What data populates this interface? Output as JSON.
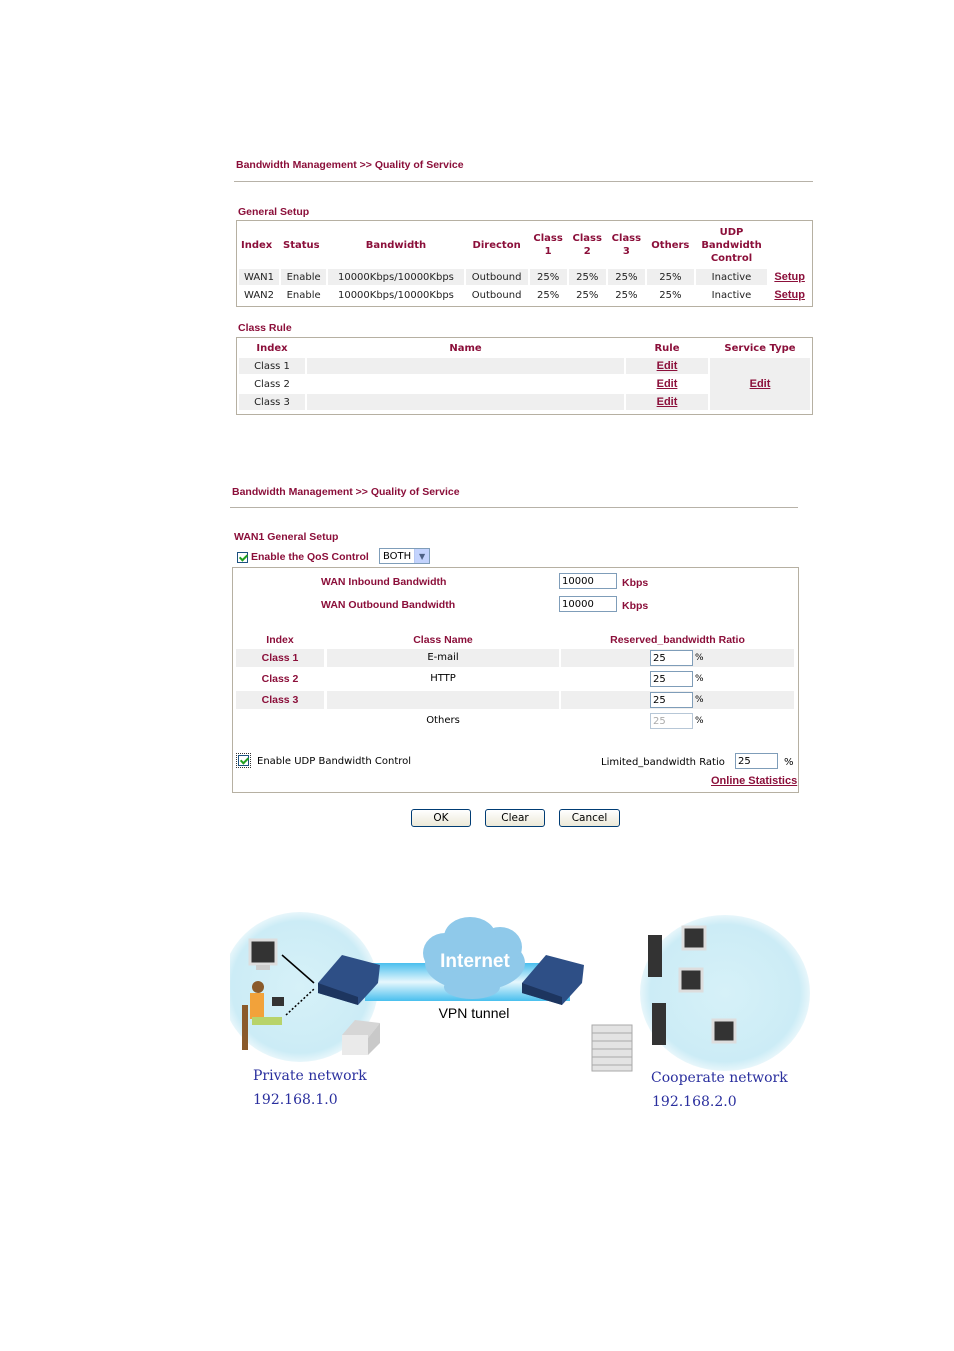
{
  "section1": {
    "breadcrumb": "Bandwidth Management >> Quality of Service",
    "general_setup": {
      "title": "General Setup",
      "columns": [
        "Index",
        "Status",
        "Bandwidth",
        "Directon",
        "Class 1",
        "Class 2",
        "Class 3",
        "Others",
        "UDP Bandwidth Control",
        ""
      ],
      "column_lines": {
        "class1": [
          "Class",
          "1"
        ],
        "class2": [
          "Class",
          "2"
        ],
        "class3": [
          "Class",
          "3"
        ],
        "udp": [
          "UDP",
          "Bandwidth",
          "Control"
        ]
      },
      "rows": [
        {
          "index": "WAN1",
          "status": "Enable",
          "bandwidth": "10000Kbps/10000Kbps",
          "direction": "Outbound",
          "class1": "25%",
          "class2": "25%",
          "class3": "25%",
          "others": "25%",
          "udp": "Inactive",
          "action": "Setup"
        },
        {
          "index": "WAN2",
          "status": "Enable",
          "bandwidth": "10000Kbps/10000Kbps",
          "direction": "Outbound",
          "class1": "25%",
          "class2": "25%",
          "class3": "25%",
          "others": "25%",
          "udp": "Inactive",
          "action": "Setup"
        }
      ]
    },
    "class_rule": {
      "title": "Class Rule",
      "columns": [
        "Index",
        "Name",
        "Rule",
        "Service Type"
      ],
      "rows": [
        {
          "index": "Class 1",
          "name": "",
          "rule": "Edit"
        },
        {
          "index": "Class 2",
          "name": "",
          "rule": "Edit"
        },
        {
          "index": "Class 3",
          "name": "",
          "rule": "Edit"
        }
      ],
      "service_type_action": "Edit"
    }
  },
  "section2": {
    "breadcrumb": "Bandwidth Management >> Quality of Service",
    "title": "WAN1 General Setup",
    "enable_qos_label": "Enable the QoS Control",
    "enable_qos_checked": true,
    "direction_select": "BOTH",
    "inbound_label": "WAN Inbound Bandwidth",
    "inbound_value": "10000",
    "outbound_label": "WAN Outbound Bandwidth",
    "outbound_value": "10000",
    "unit": "Kbps",
    "class_table": {
      "columns": [
        "Index",
        "Class Name",
        "Reserved_bandwidth Ratio"
      ],
      "rows": [
        {
          "index": "Class 1",
          "name": "E-mail",
          "ratio": "25",
          "unit": "%"
        },
        {
          "index": "Class 2",
          "name": "HTTP",
          "ratio": "25",
          "unit": "%"
        },
        {
          "index": "Class 3",
          "name": "",
          "ratio": "25",
          "unit": "%"
        },
        {
          "index": "",
          "name": "Others",
          "ratio": "25",
          "unit": "%",
          "disabled": true
        }
      ]
    },
    "udp_label": "Enable UDP Bandwidth Control",
    "udp_checked": true,
    "limited_label": "Limited_bandwidth Ratio",
    "limited_value": "25",
    "limited_unit": "%",
    "online_stats": "Online Statistics",
    "buttons": {
      "ok": "OK",
      "clear": "Clear",
      "cancel": "Cancel"
    }
  },
  "diagram": {
    "cloud_label": "Internet",
    "tunnel_label": "VPN tunnel",
    "left_network": "Private network",
    "left_ip": "192.168.1.0",
    "right_network": "Cooperate network",
    "right_ip": "192.168.2.0",
    "colors": {
      "bubble": "#d6f1f8",
      "cloud": "#8fc9ea",
      "tunnel": "#5fc6ec",
      "router": "#2e4f86",
      "label": "#2a2f9e"
    }
  }
}
